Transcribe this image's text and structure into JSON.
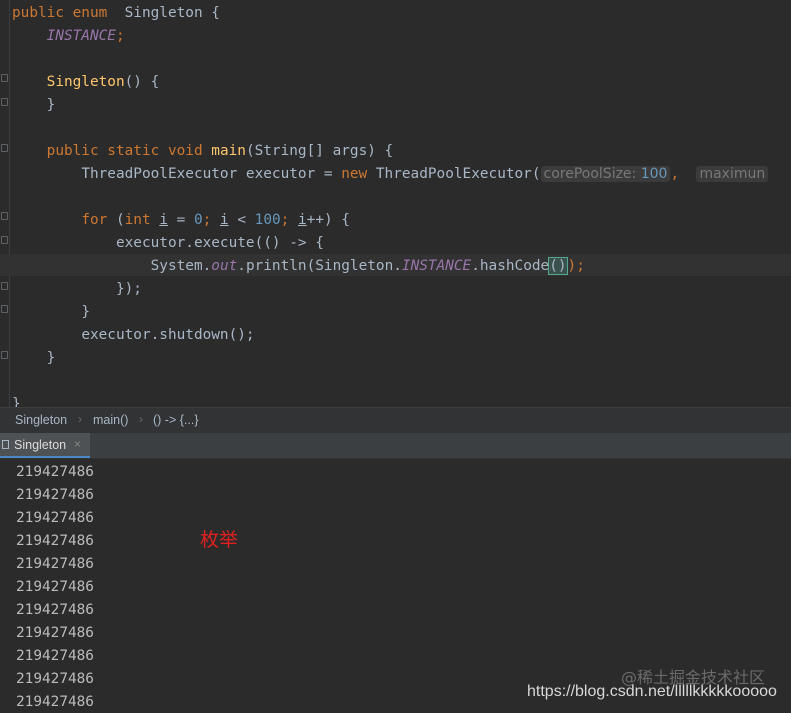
{
  "code": {
    "l1_kw": "public enum",
    "l1_name": "Singleton {",
    "l2_const": "INSTANCE",
    "l2_semi": ";",
    "l3_ctor": "Singleton",
    "l3_rest": "() {",
    "l4": "}",
    "l5_kw": "public static void",
    "l5_fn": "main",
    "l5_rest": "(String[] args) {",
    "l6_type": "ThreadPoolExecutor executor = ",
    "l6_new": "new",
    "l6_call": " ThreadPoolExecutor(",
    "l6_hint_label": "corePoolSize:",
    "l6_hint_value": "100",
    "l6_comma": ",",
    "l6_hint2": "maximun",
    "l7_for": "for",
    "l7_a": " (",
    "l7_int": "int",
    "l7_i1": "i",
    "l7_b": " = ",
    "l7_zero": "0",
    "l7_c": "; ",
    "l7_i2": "i",
    "l7_d": " < ",
    "l7_hundred": "100",
    "l7_e": "; ",
    "l7_i3": "i",
    "l7_f": "++) {",
    "l8": "executor.execute(() -> {",
    "l9_a": "System.",
    "l9_out": "out",
    "l9_b": ".println(Singleton.",
    "l9_inst": "INSTANCE",
    "l9_c": ".hashCode",
    "l9_paren": "()",
    "l9_d": ");",
    "l10": "});",
    "l11": "}",
    "l12": "executor.shutdown();",
    "l13": "}",
    "l14": "}"
  },
  "breadcrumb": {
    "items": [
      "Singleton",
      "main()",
      "() -> {...}"
    ],
    "separator": "›"
  },
  "run_panel": {
    "tab_label": "Singleton",
    "close": "×"
  },
  "console": {
    "lines": [
      "219427486",
      "219427486",
      "219427486",
      "219427486",
      "219427486",
      "219427486",
      "219427486",
      "219427486",
      "219427486",
      "219427486",
      "219427486"
    ]
  },
  "annotation": "枚举",
  "watermark": "https://blog.csdn.net/lllllkkkkkooooo",
  "watermark2": "@稀土掘金技术社区",
  "colors": {
    "background": "#2b2b2b",
    "keyword": "#cc7832",
    "constant": "#9876aa",
    "method": "#ffc66d",
    "number": "#6897bb",
    "text": "#a9b7c6",
    "annotation": "#e02020"
  }
}
